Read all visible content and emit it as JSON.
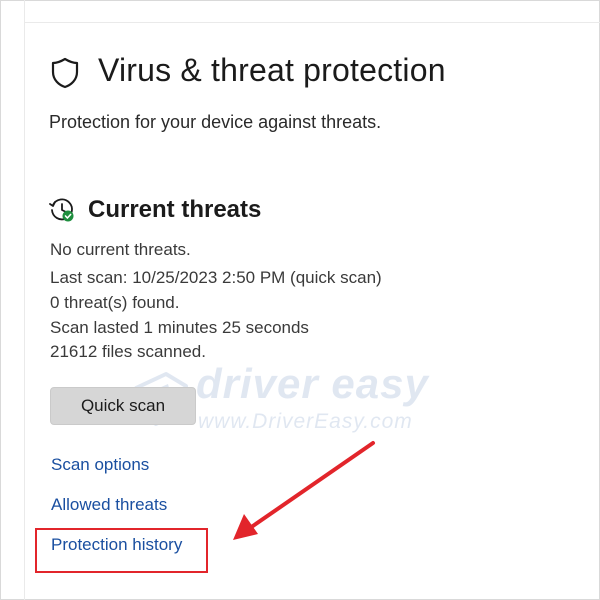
{
  "header": {
    "title": "Virus & threat protection",
    "subtitle": "Protection for your device against threats.",
    "icon": "shield-icon"
  },
  "current_threats": {
    "title": "Current threats",
    "icon": "history-check-icon",
    "status_lines": [
      "No current threats.",
      "Last scan: 10/25/2023 2:50 PM (quick scan)",
      "0 threat(s) found.",
      "Scan lasted 1 minutes 25 seconds",
      "21612 files scanned."
    ],
    "quick_scan_label": "Quick scan"
  },
  "links": [
    {
      "label": "Scan options"
    },
    {
      "label": "Allowed threats"
    },
    {
      "label": "Protection history"
    }
  ],
  "watermark": {
    "brand": "driver easy",
    "url": "www.DriverEasy.com"
  },
  "annotation": {
    "highlight_target": "Protection history",
    "color": "#e2252b"
  },
  "colors": {
    "link": "#1a4fa0",
    "button_bg": "#d6d6d6",
    "check_green": "#1e8e3e"
  }
}
